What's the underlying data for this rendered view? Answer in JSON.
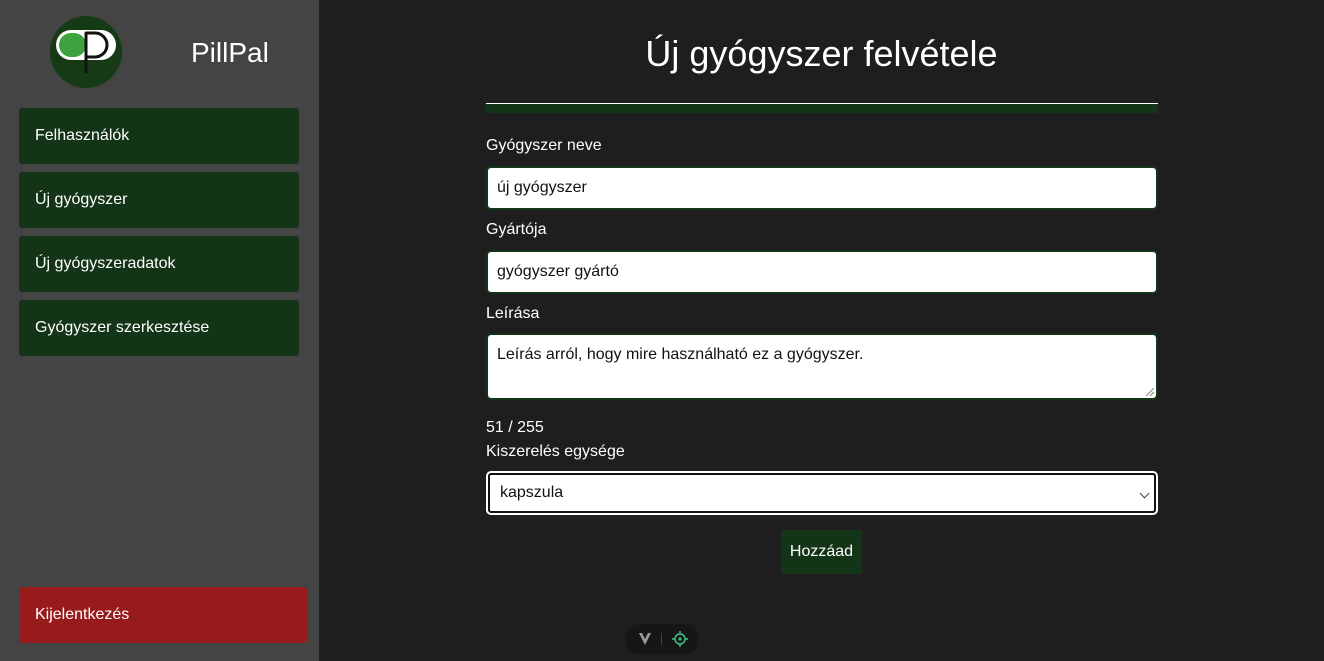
{
  "app": {
    "name": "PillPal"
  },
  "sidebar": {
    "items": [
      {
        "label": "Felhasználók"
      },
      {
        "label": "Új gyógyszer"
      },
      {
        "label": "Új gyógyszeradatok"
      },
      {
        "label": "Gyógyszer szerkesztése"
      }
    ],
    "logout_label": "Kijelentkezés"
  },
  "form": {
    "title": "Új gyógyszer felvétele",
    "name_label": "Gyógyszer neve",
    "name_value": "új gyógyszer",
    "manufacturer_label": "Gyártója",
    "manufacturer_value": "gyógyszer gyártó",
    "description_label": "Leírása",
    "description_value": "Leírás arról, hogy mire használható ez a gyógyszer.",
    "char_counter": "51 / 255",
    "unit_label": "Kiszerelés egysége",
    "unit_value": "kapszula",
    "submit_label": "Hozzáad"
  },
  "colors": {
    "sidebar_bg": "#444444",
    "main_bg": "#1e1e1e",
    "accent_green": "#133416",
    "logo_green": "#3ea33e",
    "danger_red": "#981b1c"
  },
  "icons": {
    "logo": "pillpal-logo-icon",
    "devtools_left": "vue-logo-icon",
    "devtools_right": "crosshair-icon"
  }
}
